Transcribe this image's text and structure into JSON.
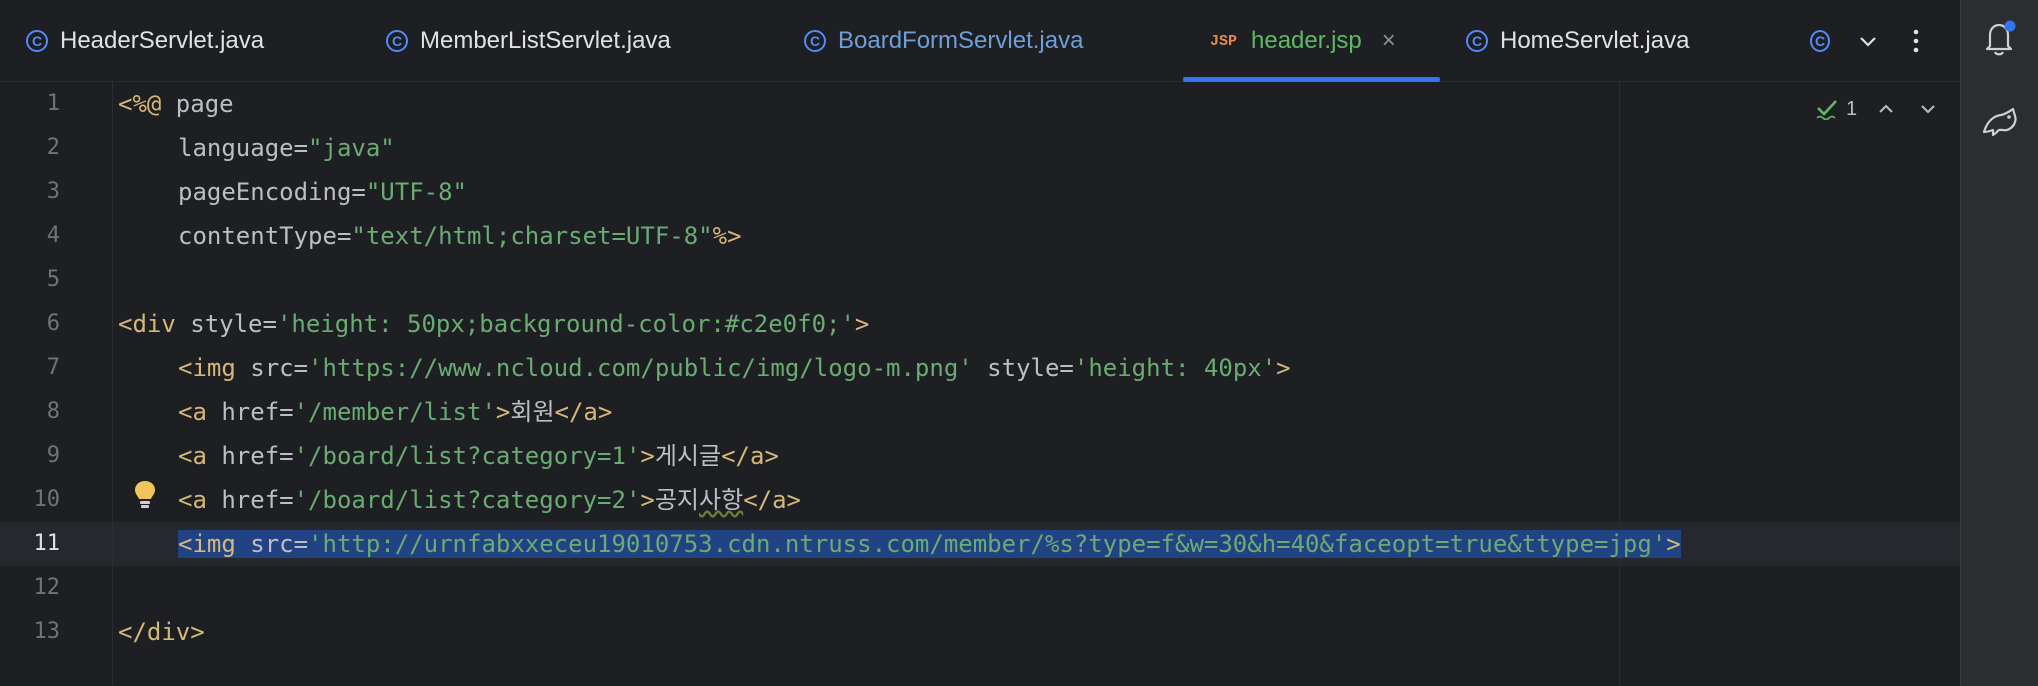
{
  "tabs": [
    {
      "label": "HeaderServlet.java",
      "icon": "class-icon",
      "state": "normal"
    },
    {
      "label": "MemberListServlet.java",
      "icon": "class-icon",
      "state": "normal"
    },
    {
      "label": "BoardFormServlet.java",
      "icon": "class-icon",
      "state": "modified"
    },
    {
      "label": "header.jsp",
      "icon": "jsp-icon",
      "icon_text": "JSP",
      "state": "active",
      "close": "×"
    },
    {
      "label": "HomeServlet.java",
      "icon": "class-icon",
      "state": "normal"
    }
  ],
  "tab_class_glyph": "C",
  "editor": {
    "current_line": 11,
    "line_numbers": [
      "1",
      "2",
      "3",
      "4",
      "5",
      "6",
      "7",
      "8",
      "9",
      "10",
      "11",
      "12",
      "13"
    ],
    "inspection": {
      "count": "1",
      "icon": "check-icon"
    },
    "code": {
      "l1": {
        "t1": "<%@",
        "t2": " page"
      },
      "l2": {
        "a1": "language=",
        "s1": "\"java\""
      },
      "l3": {
        "a1": "pageEncoding=",
        "s1": "\"UTF-8\""
      },
      "l4": {
        "a1": "contentType=",
        "s1": "\"text/html;charset=UTF-8\"",
        "t1": "%>"
      },
      "l6": {
        "t1": "<div ",
        "a1": "style=",
        "s1": "'height: 50px;background-color:#c2e0f0;'",
        "t2": ">"
      },
      "l7": {
        "t1": "<img ",
        "a1": "src=",
        "s1": "'https://www.ncloud.com/public/img/logo-m.png'",
        "a2": " style=",
        "s2": "'height: 40px'",
        "t2": ">"
      },
      "l8": {
        "t1": "<a ",
        "a1": "href=",
        "s1": "'/member/list'",
        "t2": ">",
        "x1": "회원",
        "t3": "</a>"
      },
      "l9": {
        "t1": "<a ",
        "a1": "href=",
        "s1": "'/board/list?category=1'",
        "t2": ">",
        "x1": "게시글",
        "t3": "</a>"
      },
      "l10": {
        "t1": "<a ",
        "a1": "href=",
        "s1": "'/board/list?category=2'",
        "t2": ">",
        "x1": "공지",
        "x2": "사항",
        "t3": "</a>"
      },
      "l11": {
        "t1": "<img ",
        "a1": "src=",
        "s1": "'http://urnfabxxeceu19010753.cdn.ntruss.com/member/%s?type=f&w=30&h=40&faceopt=true&ttype=jpg'",
        "t2": ">"
      },
      "l13": {
        "t1": "</div>"
      }
    }
  },
  "colors": {
    "background": "#1e1f22",
    "tag": "#d5b778",
    "string": "#6aab73",
    "selection": "#214283",
    "active_tab": "#5fb865",
    "accent": "#3574f0"
  }
}
